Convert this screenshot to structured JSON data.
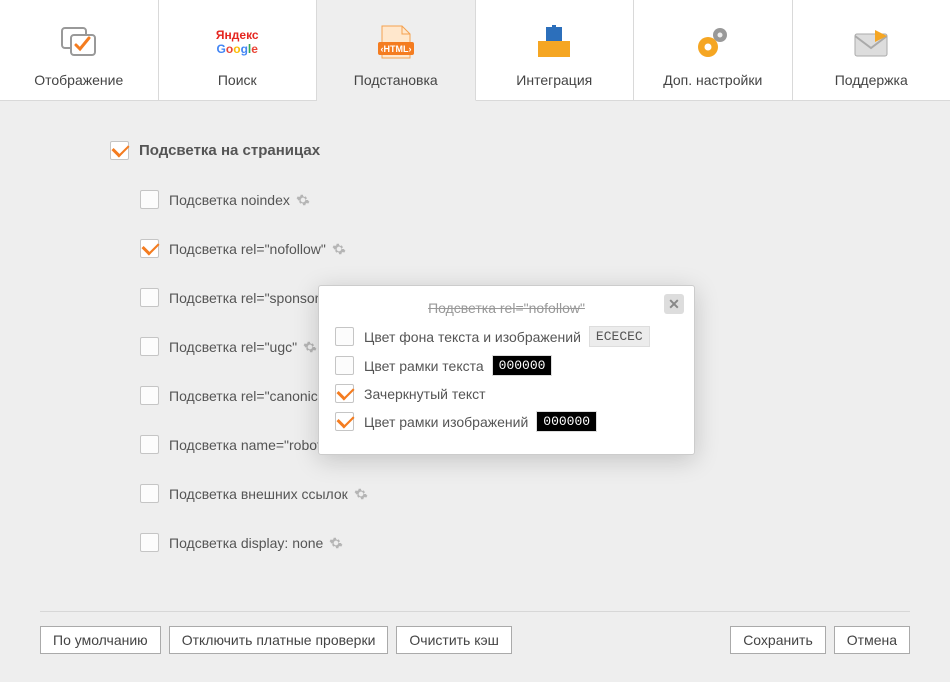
{
  "tabs": [
    {
      "label": "Отображение"
    },
    {
      "label": "Поиск"
    },
    {
      "label": "Подстановка"
    },
    {
      "label": "Интеграция"
    },
    {
      "label": "Доп. настройки"
    },
    {
      "label": "Поддержка"
    }
  ],
  "section_title": "Подсветка на страницах",
  "options": [
    {
      "label": "Подсветка noindex",
      "checked": false,
      "gear": true
    },
    {
      "label": "Подсветка rel=\"nofollow\"",
      "checked": true,
      "gear": true
    },
    {
      "label": "Подсветка rel=\"sponsored\"",
      "checked": false,
      "gear": true
    },
    {
      "label": "Подсветка rel=\"ugc\"",
      "checked": false,
      "gear": true
    },
    {
      "label": "Подсветка rel=\"canonical\"",
      "checked": false,
      "gear": true
    },
    {
      "label": "Подсветка name=\"robots\"",
      "checked": false,
      "gear": false
    },
    {
      "label": "Подсветка внешних ссылок",
      "checked": false,
      "gear": true
    },
    {
      "label": "Подсветка display: none",
      "checked": false,
      "gear": true
    }
  ],
  "popup": {
    "title": "Подсветка rel=\"nofollow\"",
    "row1_label": "Цвет фона текста и изображений",
    "row1_value": "ECECEC",
    "row2_label": "Цвет рамки текста",
    "row2_value": "000000",
    "row3_label": "Зачеркнутый текст",
    "row4_label": "Цвет рамки изображений",
    "row4_value": "000000"
  },
  "footer": {
    "defaults": "По умолчанию",
    "disable_paid": "Отключить платные проверки",
    "clear_cache": "Очистить кэш",
    "save": "Сохранить",
    "cancel": "Отмена"
  },
  "search_brands": {
    "yandex": "Яндекс",
    "google": "Google"
  }
}
